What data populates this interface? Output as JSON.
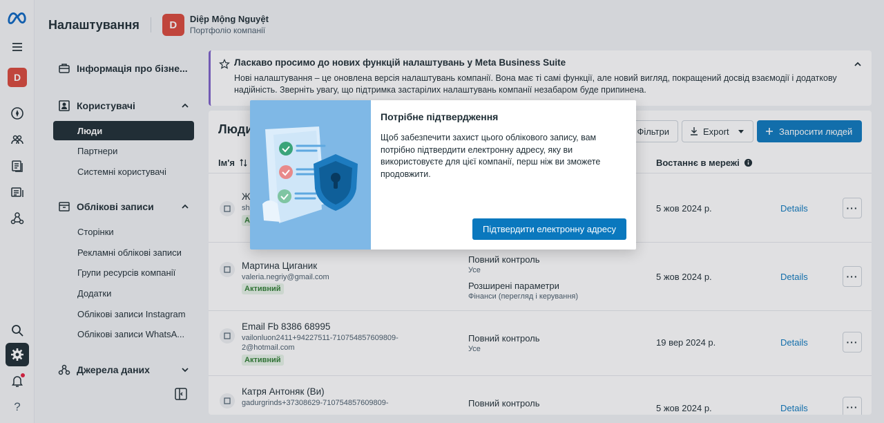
{
  "header": {
    "title": "Налаштування",
    "business_initial": "D",
    "business_name": "Diệp Mộng Nguyệt",
    "business_subtitle": "Портфоліо компанії"
  },
  "rail": {
    "avatar_initial": "D",
    "icons": [
      "meta-logo-icon",
      "menu-icon",
      "compass-icon",
      "people-icon",
      "pages-icon",
      "catalog-icon",
      "network-icon",
      "search-icon",
      "settings-icon",
      "bell-icon",
      "help-icon"
    ],
    "help_label": "?"
  },
  "sidebar": {
    "business_info": "Інформація про бізне...",
    "users_section": "Користувачі",
    "users_items": [
      "Люди",
      "Партнери",
      "Системні користувачі"
    ],
    "accounts_section": "Облікові записи",
    "accounts_items": [
      "Сторінки",
      "Рекламні облікові записи",
      "Групи ресурсів компанії",
      "Додатки",
      "Облікові записи Instagram",
      "Облікові записи WhatsA..."
    ],
    "data_sources_section": "Джерела даних"
  },
  "banner": {
    "title": "Ласкаво просимо до нових функцій налаштувань у Meta Business Suite",
    "text": "Нові налаштування – це оновлена версія налаштувань компанії. Вона має ті самі функції, але новий вигляд, покращений досвід взаємодії і додаткову надійність. Зверніть увагу, що підтримка застарілих налаштувань компанії незабаром буде припинена."
  },
  "people": {
    "title": "Люди",
    "filters_label": "Фільтри",
    "export_label": "Export",
    "invite_label": "Запросити людей",
    "col_name": "Ім'я",
    "col_last_seen": "Востаннє в мережі",
    "details_label": "Details",
    "rows": [
      {
        "name": "Ж",
        "email": "sh",
        "status": "Акт",
        "perm": "",
        "perm_sub": "",
        "perm2": "",
        "perm2_sub": "",
        "last_seen": "5 жов 2024 р."
      },
      {
        "name": "Мартина Циганик",
        "email": "valeria.negriy@gmail.com",
        "status": "Активний",
        "perm": "Повний контроль",
        "perm_sub": "Усе",
        "perm2": "Розширені параметри",
        "perm2_sub": "Фінанси (перегляд і керування)",
        "last_seen": "5 жов 2024 р."
      },
      {
        "name": "Email Fb 8386 68995",
        "email": "vailonluon2411+94227511-710754857609809-2@hotmail.com",
        "status": "Активний",
        "perm": "Повний контроль",
        "perm_sub": "Усе",
        "perm2": "",
        "perm2_sub": "",
        "last_seen": "19 вер 2024 р."
      },
      {
        "name": "Катря Антоняк (Ви)",
        "email": "gadurgrinds+37308629-710754857609809-",
        "status": "",
        "perm": "Повний контроль",
        "perm_sub": "",
        "perm2": "",
        "perm2_sub": "",
        "last_seen": "5 жов 2024 р."
      }
    ]
  },
  "modal": {
    "title": "Потрібне підтвердження",
    "text": "Щоб забезпечити захист цього облікового запису, вам потрібно підтвердити електронну адресу, яку ви використовуєте для цієї компанії, перш ніж ви зможете продовжити.",
    "confirm_label": "Підтвердити електронну адресу"
  },
  "colors": {
    "accent": "#0a78be",
    "avatar": "#d9473a",
    "banner_border": "#7d60c9",
    "active_nav": "#1c2b33"
  }
}
